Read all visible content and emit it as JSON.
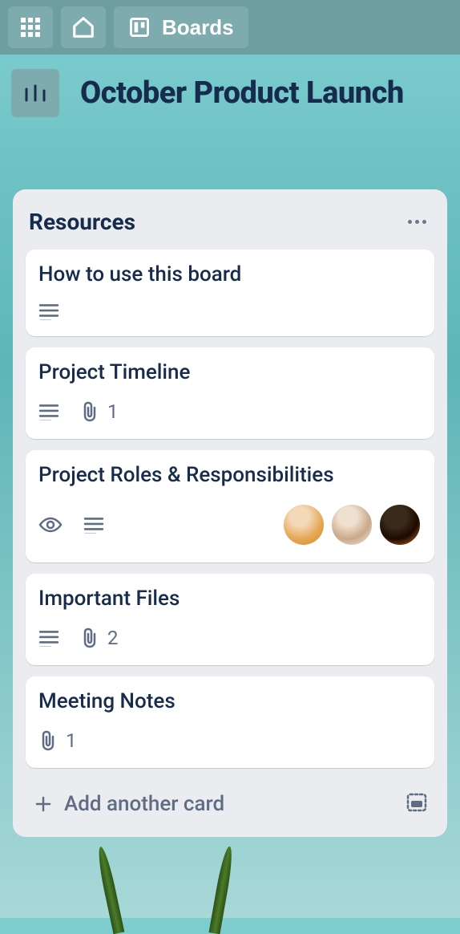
{
  "nav": {
    "boards_label": "Boards"
  },
  "board": {
    "title": "October Product Launch"
  },
  "list": {
    "title": "Resources",
    "add_card_label": "Add another card",
    "cards": [
      {
        "title": "How to use this board",
        "has_description": true,
        "has_watch": false,
        "attachments": null,
        "members": 0
      },
      {
        "title": "Project Timeline",
        "has_description": true,
        "has_watch": false,
        "attachments": "1",
        "members": 0
      },
      {
        "title": "Project Roles & Responsibilities",
        "has_description": true,
        "has_watch": true,
        "attachments": null,
        "members": 3
      },
      {
        "title": "Important Files",
        "has_description": true,
        "has_watch": false,
        "attachments": "2",
        "members": 0
      },
      {
        "title": "Meeting Notes",
        "has_description": false,
        "has_watch": false,
        "attachments": "1",
        "members": 0
      }
    ]
  }
}
